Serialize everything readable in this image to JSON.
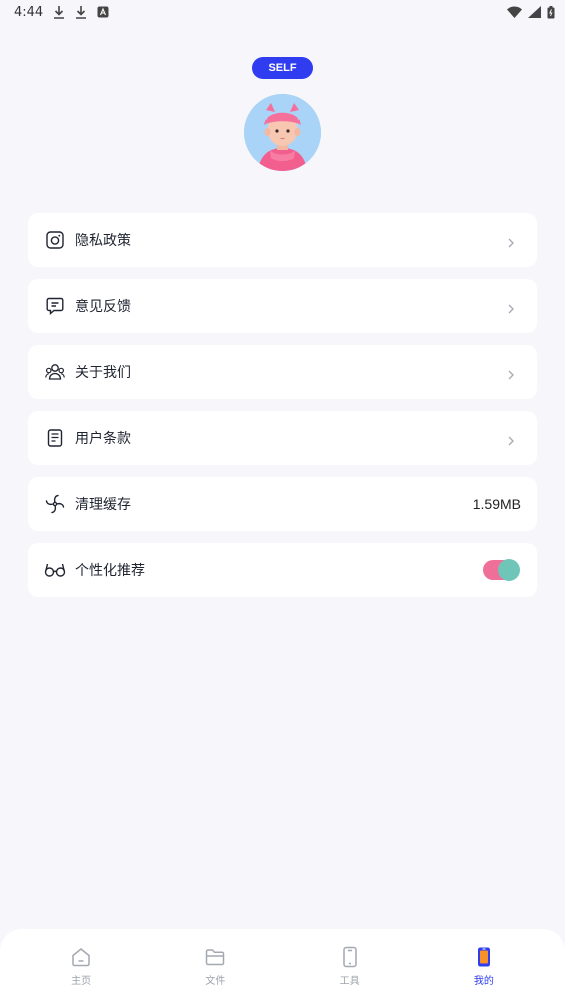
{
  "status_bar": {
    "time": "4:44"
  },
  "profile": {
    "badge": "SELF"
  },
  "menu": {
    "items": [
      {
        "label": "隐私政策",
        "icon": "instagram-square-icon"
      },
      {
        "label": "意见反馈",
        "icon": "message-icon"
      },
      {
        "label": "关于我们",
        "icon": "group-icon"
      },
      {
        "label": "用户条款",
        "icon": "document-icon"
      },
      {
        "label": "清理缓存",
        "icon": "fan-icon",
        "value": "1.59MB"
      },
      {
        "label": "个性化推荐",
        "icon": "glasses-icon",
        "toggle": true
      }
    ]
  },
  "nav": {
    "items": [
      {
        "label": "主页",
        "icon": "home-icon"
      },
      {
        "label": "文件",
        "icon": "folder-icon"
      },
      {
        "label": "工具",
        "icon": "phone-icon"
      },
      {
        "label": "我的",
        "icon": "my-phone-icon",
        "active": true
      }
    ]
  },
  "colors": {
    "accent": "#2f3cf0",
    "toggle_track": "#ef6f98",
    "toggle_knob": "#6fc6b8",
    "background": "#f6f6fb"
  }
}
